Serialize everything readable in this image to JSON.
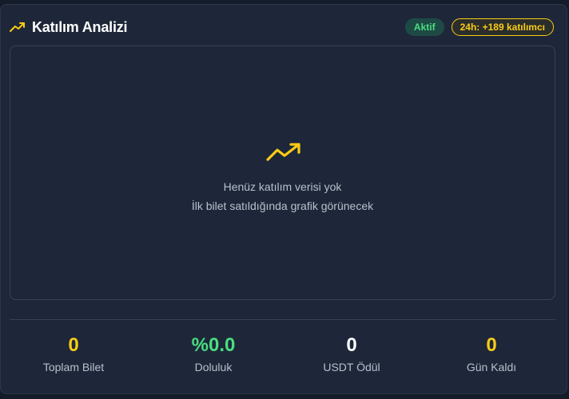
{
  "header": {
    "title": "Katılım Analizi",
    "title_icon": "trending-up-icon",
    "status_badge": "Aktif",
    "activity_badge": "24h: +189 katılımcı"
  },
  "empty_state": {
    "icon": "trending-up-icon",
    "line1": "Henüz katılım verisi yok",
    "line2": "İlk bilet satıldığında grafik görünecek"
  },
  "stats": [
    {
      "value": "0",
      "label": "Toplam Bilet",
      "color": "#facc15"
    },
    {
      "value": "%0.0",
      "label": "Doluluk",
      "color": "#4ade80"
    },
    {
      "value": "0",
      "label": "USDT Ödül",
      "color": "#ffffff"
    },
    {
      "value": "0",
      "label": "Gün Kaldı",
      "color": "#facc15"
    }
  ],
  "colors": {
    "accent_yellow": "#facc15",
    "accent_green": "#4ade80",
    "card_bg": "#1e2739",
    "muted_text": "#b8c0cc"
  }
}
